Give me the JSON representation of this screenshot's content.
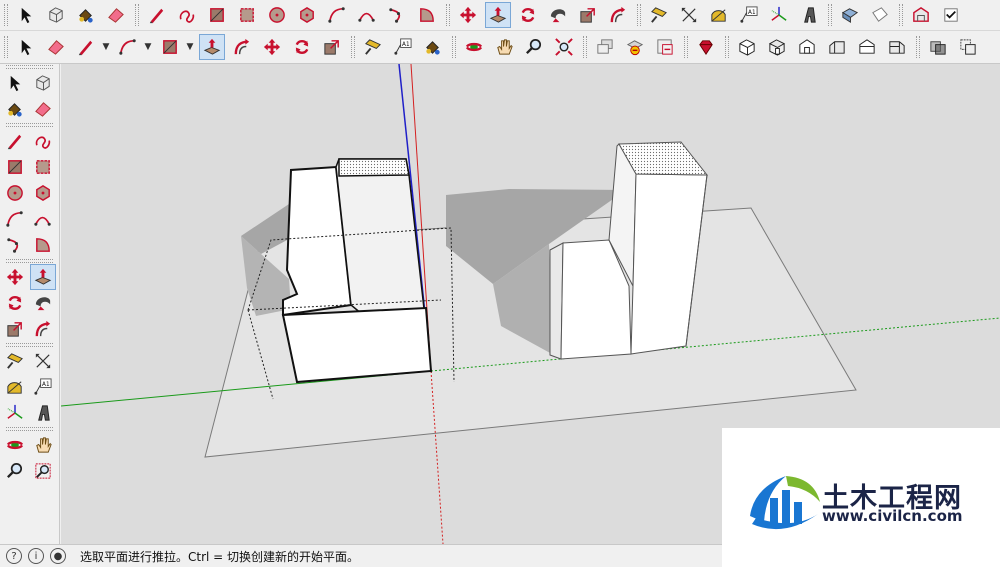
{
  "toolbar_top": {
    "items": [
      {
        "icon": "select-arrow-icon"
      },
      {
        "icon": "component-icon"
      },
      {
        "icon": "paint-bucket-icon"
      },
      {
        "icon": "eraser-icon"
      },
      {
        "sep": true
      },
      {
        "icon": "pencil-line-icon"
      },
      {
        "icon": "freehand-icon"
      },
      {
        "icon": "rectangle-icon"
      },
      {
        "icon": "rotated-rectangle-icon"
      },
      {
        "icon": "circle-icon"
      },
      {
        "icon": "polygon-icon"
      },
      {
        "icon": "arc-icon"
      },
      {
        "icon": "two-point-arc-icon"
      },
      {
        "icon": "three-point-arc-icon"
      },
      {
        "icon": "pie-icon"
      },
      {
        "sep": true
      },
      {
        "icon": "move-icon"
      },
      {
        "icon": "push-pull-icon",
        "active": true
      },
      {
        "icon": "rotate-icon"
      },
      {
        "icon": "follow-me-icon"
      },
      {
        "icon": "scale-icon"
      },
      {
        "icon": "offset-icon"
      },
      {
        "sep": true
      },
      {
        "icon": "tape-measure-icon"
      },
      {
        "icon": "dimension-icon"
      },
      {
        "icon": "protractor-icon"
      },
      {
        "icon": "text-label-icon"
      },
      {
        "icon": "axes-icon"
      },
      {
        "icon": "3d-text-icon"
      },
      {
        "sep": true
      },
      {
        "icon": "solid-box-icon"
      },
      {
        "icon": "sandbox-icon"
      },
      {
        "sep": true
      },
      {
        "icon": "warehouse-icon"
      },
      {
        "icon": "checkbox-icon"
      }
    ]
  },
  "toolbar_second": {
    "items": [
      {
        "icon": "select-arrow-icon"
      },
      {
        "icon": "eraser-icon"
      },
      {
        "icon": "pencil-line-icon",
        "dropdown": true
      },
      {
        "icon": "arc-icon",
        "dropdown": true
      },
      {
        "icon": "rectangle-icon",
        "dropdown": true
      },
      {
        "icon": "push-pull-icon",
        "active": true
      },
      {
        "icon": "offset-icon"
      },
      {
        "icon": "move-icon"
      },
      {
        "icon": "rotate-icon"
      },
      {
        "icon": "scale-icon"
      },
      {
        "sep": true
      },
      {
        "icon": "tape-measure-icon"
      },
      {
        "icon": "text-label-icon"
      },
      {
        "icon": "paint-bucket-icon"
      },
      {
        "sep": true
      },
      {
        "icon": "orbit-icon"
      },
      {
        "icon": "pan-hand-icon"
      },
      {
        "icon": "zoom-icon"
      },
      {
        "icon": "zoom-extents-icon"
      },
      {
        "sep": true
      },
      {
        "icon": "previous-view-icon"
      },
      {
        "icon": "get-models-icon"
      },
      {
        "icon": "share-model-icon"
      },
      {
        "sep": true
      },
      {
        "icon": "ruby-extension-icon"
      },
      {
        "sep": true
      },
      {
        "icon": "iso-view-icon"
      },
      {
        "icon": "top-view-icon"
      },
      {
        "icon": "front-view-icon"
      },
      {
        "icon": "right-view-icon"
      },
      {
        "icon": "back-view-icon"
      },
      {
        "icon": "left-view-icon"
      },
      {
        "sep": true
      },
      {
        "icon": "xray-icon"
      },
      {
        "icon": "back-edges-icon"
      }
    ]
  },
  "left_toolbar": {
    "rows": [
      [
        {
          "icon": "select-arrow-icon"
        },
        {
          "icon": "component-icon"
        }
      ],
      [
        {
          "icon": "paint-bucket-icon"
        },
        {
          "icon": "eraser-icon"
        }
      ],
      "sep",
      [
        {
          "icon": "pencil-line-icon"
        },
        {
          "icon": "freehand-icon"
        }
      ],
      [
        {
          "icon": "rectangle-icon"
        },
        {
          "icon": "rotated-rectangle-icon"
        }
      ],
      [
        {
          "icon": "circle-icon"
        },
        {
          "icon": "polygon-icon"
        }
      ],
      [
        {
          "icon": "arc-icon"
        },
        {
          "icon": "two-point-arc-icon"
        }
      ],
      [
        {
          "icon": "three-point-arc-icon"
        },
        {
          "icon": "pie-icon"
        }
      ],
      "sep",
      [
        {
          "icon": "move-icon"
        },
        {
          "icon": "push-pull-icon",
          "active": true
        }
      ],
      [
        {
          "icon": "rotate-icon"
        },
        {
          "icon": "follow-me-icon"
        }
      ],
      [
        {
          "icon": "scale-icon"
        },
        {
          "icon": "offset-icon"
        }
      ],
      "sep",
      [
        {
          "icon": "tape-measure-icon"
        },
        {
          "icon": "dimension-icon"
        }
      ],
      [
        {
          "icon": "protractor-icon"
        },
        {
          "icon": "text-label-icon"
        }
      ],
      [
        {
          "icon": "axes-icon"
        },
        {
          "icon": "3d-text-icon"
        }
      ],
      "sep",
      [
        {
          "icon": "orbit-icon"
        },
        {
          "icon": "pan-hand-icon"
        }
      ],
      [
        {
          "icon": "zoom-icon"
        },
        {
          "icon": "zoom-window-icon"
        }
      ]
    ]
  },
  "label_text": "A1",
  "status": {
    "text": "选取平面进行推拉。Ctrl = 切换创建新的开始平面。",
    "icons": [
      "geolocation-icon",
      "credits-icon",
      "user-icon"
    ]
  },
  "watermark": {
    "name": "土木工程网",
    "url": "www.civilcn.com"
  },
  "colors": {
    "viewport_bg": "#dcdcdc",
    "ground_plane": "#e4e4e4",
    "face_light": "#ffffff",
    "face_shade": "#f2f2f2",
    "shadow": "#a6a6a6",
    "axis_red": "#d42020",
    "axis_green": "#1a9a1a",
    "axis_blue": "#2020c8",
    "icon_red": "#c8102e",
    "brand_navy": "#1b2447",
    "brand_blue": "#1976d2",
    "brand_green": "#7cb82f"
  }
}
